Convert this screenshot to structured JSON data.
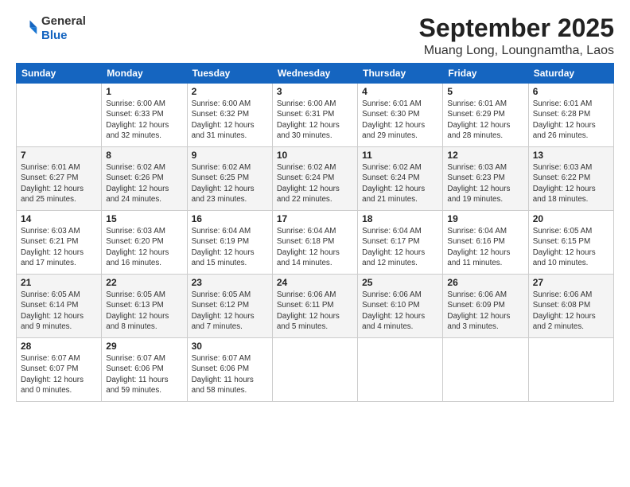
{
  "header": {
    "logo_general": "General",
    "logo_blue": "Blue",
    "month_title": "September 2025",
    "location": "Muang Long, Loungnamtha, Laos"
  },
  "weekdays": [
    "Sunday",
    "Monday",
    "Tuesday",
    "Wednesday",
    "Thursday",
    "Friday",
    "Saturday"
  ],
  "weeks": [
    [
      {
        "day": "",
        "info": ""
      },
      {
        "day": "1",
        "info": "Sunrise: 6:00 AM\nSunset: 6:33 PM\nDaylight: 12 hours\nand 32 minutes."
      },
      {
        "day": "2",
        "info": "Sunrise: 6:00 AM\nSunset: 6:32 PM\nDaylight: 12 hours\nand 31 minutes."
      },
      {
        "day": "3",
        "info": "Sunrise: 6:00 AM\nSunset: 6:31 PM\nDaylight: 12 hours\nand 30 minutes."
      },
      {
        "day": "4",
        "info": "Sunrise: 6:01 AM\nSunset: 6:30 PM\nDaylight: 12 hours\nand 29 minutes."
      },
      {
        "day": "5",
        "info": "Sunrise: 6:01 AM\nSunset: 6:29 PM\nDaylight: 12 hours\nand 28 minutes."
      },
      {
        "day": "6",
        "info": "Sunrise: 6:01 AM\nSunset: 6:28 PM\nDaylight: 12 hours\nand 26 minutes."
      }
    ],
    [
      {
        "day": "7",
        "info": "Sunrise: 6:01 AM\nSunset: 6:27 PM\nDaylight: 12 hours\nand 25 minutes."
      },
      {
        "day": "8",
        "info": "Sunrise: 6:02 AM\nSunset: 6:26 PM\nDaylight: 12 hours\nand 24 minutes."
      },
      {
        "day": "9",
        "info": "Sunrise: 6:02 AM\nSunset: 6:25 PM\nDaylight: 12 hours\nand 23 minutes."
      },
      {
        "day": "10",
        "info": "Sunrise: 6:02 AM\nSunset: 6:24 PM\nDaylight: 12 hours\nand 22 minutes."
      },
      {
        "day": "11",
        "info": "Sunrise: 6:02 AM\nSunset: 6:24 PM\nDaylight: 12 hours\nand 21 minutes."
      },
      {
        "day": "12",
        "info": "Sunrise: 6:03 AM\nSunset: 6:23 PM\nDaylight: 12 hours\nand 19 minutes."
      },
      {
        "day": "13",
        "info": "Sunrise: 6:03 AM\nSunset: 6:22 PM\nDaylight: 12 hours\nand 18 minutes."
      }
    ],
    [
      {
        "day": "14",
        "info": "Sunrise: 6:03 AM\nSunset: 6:21 PM\nDaylight: 12 hours\nand 17 minutes."
      },
      {
        "day": "15",
        "info": "Sunrise: 6:03 AM\nSunset: 6:20 PM\nDaylight: 12 hours\nand 16 minutes."
      },
      {
        "day": "16",
        "info": "Sunrise: 6:04 AM\nSunset: 6:19 PM\nDaylight: 12 hours\nand 15 minutes."
      },
      {
        "day": "17",
        "info": "Sunrise: 6:04 AM\nSunset: 6:18 PM\nDaylight: 12 hours\nand 14 minutes."
      },
      {
        "day": "18",
        "info": "Sunrise: 6:04 AM\nSunset: 6:17 PM\nDaylight: 12 hours\nand 12 minutes."
      },
      {
        "day": "19",
        "info": "Sunrise: 6:04 AM\nSunset: 6:16 PM\nDaylight: 12 hours\nand 11 minutes."
      },
      {
        "day": "20",
        "info": "Sunrise: 6:05 AM\nSunset: 6:15 PM\nDaylight: 12 hours\nand 10 minutes."
      }
    ],
    [
      {
        "day": "21",
        "info": "Sunrise: 6:05 AM\nSunset: 6:14 PM\nDaylight: 12 hours\nand 9 minutes."
      },
      {
        "day": "22",
        "info": "Sunrise: 6:05 AM\nSunset: 6:13 PM\nDaylight: 12 hours\nand 8 minutes."
      },
      {
        "day": "23",
        "info": "Sunrise: 6:05 AM\nSunset: 6:12 PM\nDaylight: 12 hours\nand 7 minutes."
      },
      {
        "day": "24",
        "info": "Sunrise: 6:06 AM\nSunset: 6:11 PM\nDaylight: 12 hours\nand 5 minutes."
      },
      {
        "day": "25",
        "info": "Sunrise: 6:06 AM\nSunset: 6:10 PM\nDaylight: 12 hours\nand 4 minutes."
      },
      {
        "day": "26",
        "info": "Sunrise: 6:06 AM\nSunset: 6:09 PM\nDaylight: 12 hours\nand 3 minutes."
      },
      {
        "day": "27",
        "info": "Sunrise: 6:06 AM\nSunset: 6:08 PM\nDaylight: 12 hours\nand 2 minutes."
      }
    ],
    [
      {
        "day": "28",
        "info": "Sunrise: 6:07 AM\nSunset: 6:07 PM\nDaylight: 12 hours\nand 0 minutes."
      },
      {
        "day": "29",
        "info": "Sunrise: 6:07 AM\nSunset: 6:06 PM\nDaylight: 11 hours\nand 59 minutes."
      },
      {
        "day": "30",
        "info": "Sunrise: 6:07 AM\nSunset: 6:06 PM\nDaylight: 11 hours\nand 58 minutes."
      },
      {
        "day": "",
        "info": ""
      },
      {
        "day": "",
        "info": ""
      },
      {
        "day": "",
        "info": ""
      },
      {
        "day": "",
        "info": ""
      }
    ]
  ]
}
